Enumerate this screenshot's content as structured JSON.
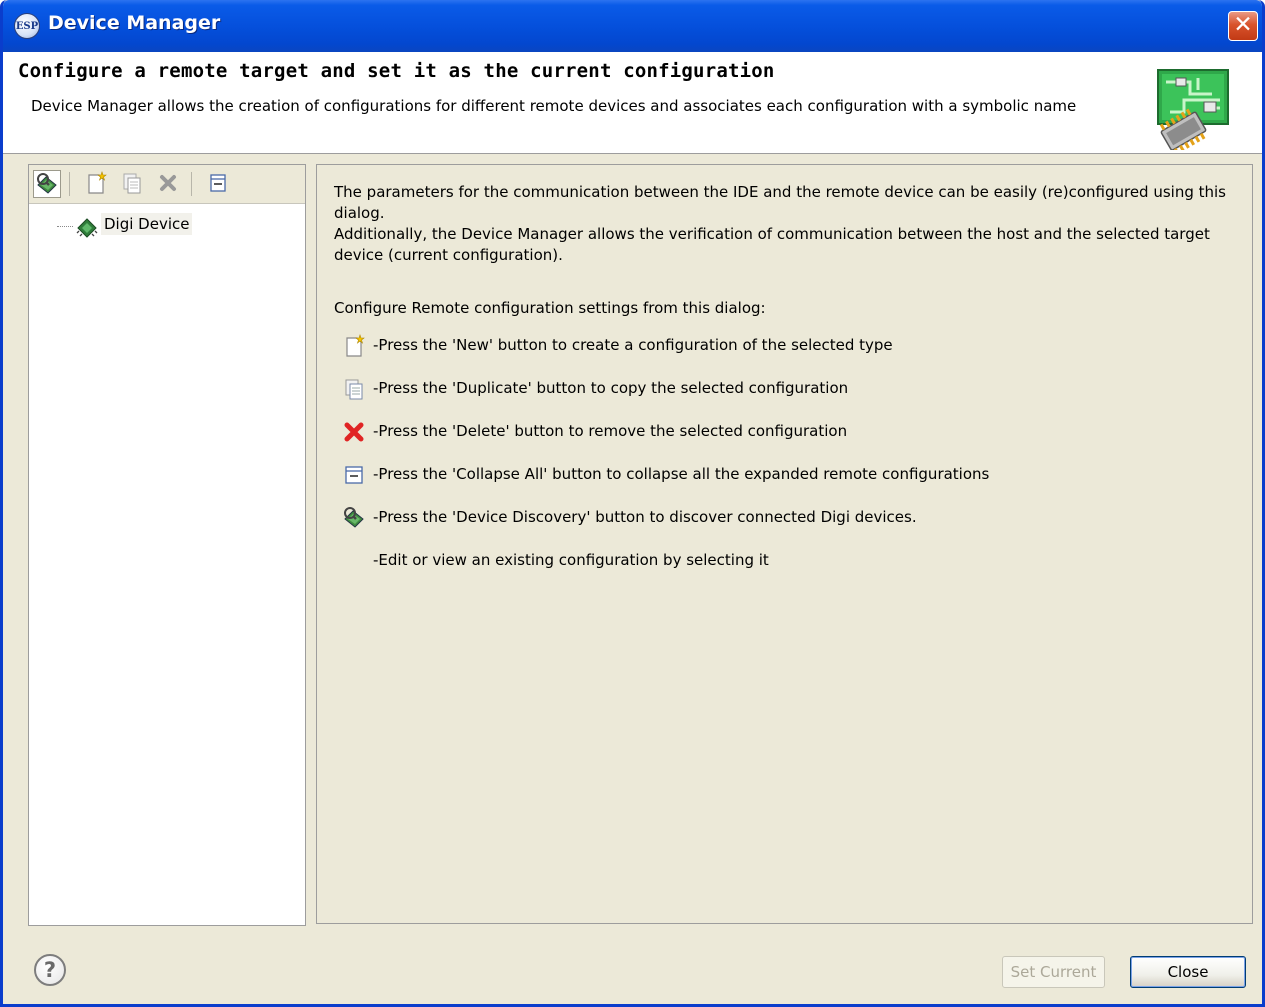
{
  "window": {
    "title": "Device Manager",
    "logo_text": "ESP",
    "close_glyph": "✕",
    "title_bar_color": "#0550DC",
    "dialog_bg": "#ECE9D8"
  },
  "header": {
    "title": "Configure a remote target and set it as the current configuration",
    "description": "Device Manager allows the creation of configurations for different remote devices and associates each configuration with a symbolic name",
    "art_icon": "circuit-board-chip-icon"
  },
  "toolbar": {
    "items": [
      {
        "name": "device-discovery-icon"
      },
      {
        "name": "new-config-icon"
      },
      {
        "name": "duplicate-config-icon"
      },
      {
        "name": "delete-config-icon"
      },
      {
        "name": "collapse-all-icon"
      }
    ]
  },
  "tree": {
    "items": [
      {
        "label": "Digi Device",
        "icon": "digi-device-icon"
      }
    ]
  },
  "info": {
    "paragraph1": "The parameters for the communication between the IDE and the remote device can be easily (re)configured using this dialog.",
    "paragraph2": "Additionally, the Device Manager allows the verification of communication between the host and the selected target device (current configuration).",
    "subheading": "Configure Remote configuration settings from this dialog:",
    "instructions": [
      {
        "icon": "new-icon",
        "text": "-Press the 'New' button to create a configuration of the selected type"
      },
      {
        "icon": "duplicate-icon",
        "text": "-Press the 'Duplicate' button to copy the selected configuration"
      },
      {
        "icon": "delete-icon",
        "text": "-Press the 'Delete' button to remove the selected configuration"
      },
      {
        "icon": "collapse-all-icon",
        "text": "-Press the 'Collapse All' button to collapse all the expanded remote configurations"
      },
      {
        "icon": "device-discovery-icon",
        "text": "-Press the 'Device Discovery' button to discover connected Digi devices."
      },
      {
        "icon": "",
        "text": "-Edit or view an existing configuration by selecting it"
      }
    ]
  },
  "footer": {
    "help_glyph": "?",
    "set_current_label": "Set Current",
    "close_label": "Close"
  }
}
